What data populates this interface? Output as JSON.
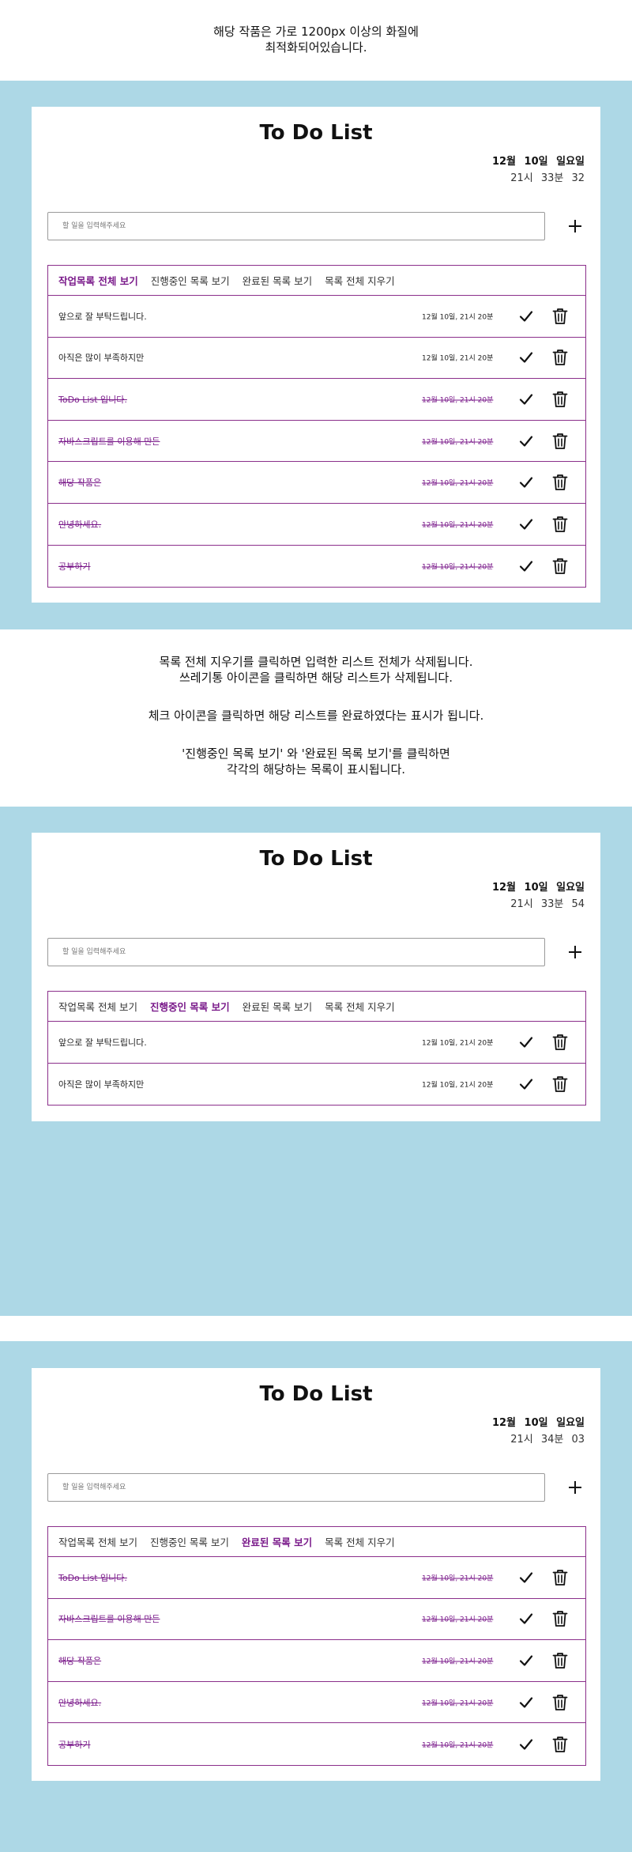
{
  "intro": {
    "line1": "해당 작품은 가로 1200px 이상의 화질에",
    "line2": "최적화되어있습니다."
  },
  "instructions": {
    "line1": "목록 전체 지우기를 클릭하면 입력한 리스트 전체가 삭제됩니다.",
    "line2": "쓰레기통 아이콘을 클릭하면 해당 리스트가 삭제됩니다.",
    "line3": "체크 아이콘을 클릭하면 해당 리스트를 완료하였다는 표시가 됩니다.",
    "line4": "'진행중인 목록 보기' 와 '완료된 목록 보기'를 클릭하면",
    "line5": "각각의 해당하는 목록이 표시됩니다."
  },
  "colors": {
    "background_panel": "#add8e6",
    "accent": "#7a1a8a",
    "border": "#8b2f8b"
  },
  "icons": {
    "add": "plus-icon",
    "check": "check-icon",
    "delete": "trash-icon"
  },
  "screens": [
    {
      "title": "To Do List",
      "date": "12월 10일 일요일",
      "time": "21시 33분 32",
      "input_placeholder": "할 일을 입력해주세요",
      "tabs": [
        "작업목록 전체 보기",
        "진행중인 목록 보기",
        "완료된 목록 보기",
        "목록 전체 지우기"
      ],
      "active_tab": 0,
      "items": [
        {
          "text": "앞으로 잘 부탁드립니다.",
          "time": "12월 10일, 21시 20분",
          "done": false
        },
        {
          "text": "아직은 많이 부족하지만",
          "time": "12월 10일, 21시 20분",
          "done": false
        },
        {
          "text": "ToDo List 입니다.",
          "time": "12월 10일, 21시 20분",
          "done": true
        },
        {
          "text": "자바스크립트를 이용해 만든",
          "time": "12월 10일, 21시 20분",
          "done": true
        },
        {
          "text": "해당 작품은",
          "time": "12월 10일, 21시 20분",
          "done": true
        },
        {
          "text": "안녕하세요.",
          "time": "12월 10일, 21시 20분",
          "done": true
        },
        {
          "text": "공부하기",
          "time": "12월 10일, 21시 20분",
          "done": true
        }
      ]
    },
    {
      "title": "To Do List",
      "date": "12월 10일 일요일",
      "time": "21시 33분 54",
      "input_placeholder": "할 일을 입력해주세요",
      "tabs": [
        "작업목록 전체 보기",
        "진행중인 목록 보기",
        "완료된 목록 보기",
        "목록 전체 지우기"
      ],
      "active_tab": 1,
      "items": [
        {
          "text": "앞으로 잘 부탁드립니다.",
          "time": "12월 10일, 21시 20분",
          "done": false
        },
        {
          "text": "아직은 많이 부족하지만",
          "time": "12월 10일, 21시 20분",
          "done": false
        }
      ]
    },
    {
      "title": "To Do List",
      "date": "12월 10일 일요일",
      "time": "21시 34분 03",
      "input_placeholder": "할 일을 입력해주세요",
      "tabs": [
        "작업목록 전체 보기",
        "진행중인 목록 보기",
        "완료된 목록 보기",
        "목록 전체 지우기"
      ],
      "active_tab": 2,
      "items": [
        {
          "text": "ToDo List 입니다.",
          "time": "12월 10일, 21시 20분",
          "done": true
        },
        {
          "text": "자바스크립트를 이용해 만든",
          "time": "12월 10일, 21시 20분",
          "done": true
        },
        {
          "text": "해당 작품은",
          "time": "12월 10일, 21시 20분",
          "done": true
        },
        {
          "text": "안녕하세요.",
          "time": "12월 10일, 21시 20분",
          "done": true
        },
        {
          "text": "공부하기",
          "time": "12월 10일, 21시 20분",
          "done": true
        }
      ]
    }
  ]
}
